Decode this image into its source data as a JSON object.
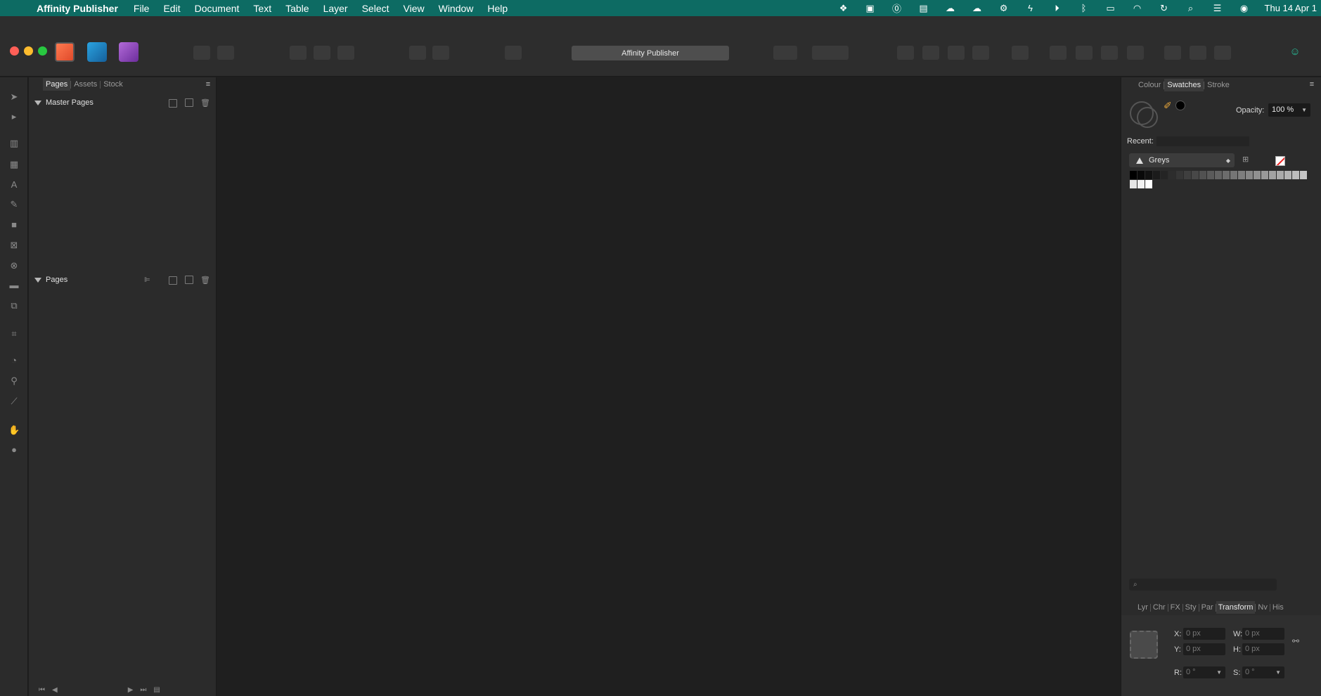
{
  "menubar": {
    "apple": "",
    "items": [
      "Affinity Publisher",
      "File",
      "Edit",
      "Document",
      "Text",
      "Table",
      "Layer",
      "Select",
      "View",
      "Window",
      "Help"
    ],
    "status_icons": [
      "dropbox-icon",
      "app-icon",
      "1password-icon",
      "app-icon",
      "cloud-icon",
      "cloud-icon",
      "gear-icon",
      "bolt-icon",
      "play-icon",
      "bluetooth-icon",
      "battery-icon",
      "wifi-icon",
      "time-machine-icon",
      "search-icon",
      "control-center-icon",
      "siri-icon"
    ],
    "clock": "Thu 14 Apr 1"
  },
  "toolbar": {
    "document_title": "Affinity Publisher"
  },
  "left_panel": {
    "tabs": [
      "Pages",
      "Assets",
      "Stock"
    ],
    "active_tab": "Pages",
    "master_pages_label": "Master Pages",
    "pages_label": "Pages"
  },
  "right_panel": {
    "tabs": [
      "Colour",
      "Swatches",
      "Stroke"
    ],
    "active_tab": "Swatches",
    "opacity_label": "Opacity:",
    "opacity_value": "100 %",
    "recent_label": "Recent:",
    "palette_name": "Greys",
    "bottom_tabs": [
      "Lyr",
      "Chr",
      "FX",
      "Sty",
      "Par",
      "Transform",
      "Nv",
      "His"
    ],
    "bottom_active_tab": "Transform",
    "transform": {
      "x_label": "X:",
      "x_value": "0 px",
      "y_label": "Y:",
      "y_value": "0 px",
      "w_label": "W:",
      "w_value": "0 px",
      "h_label": "H:",
      "h_value": "0 px",
      "r_label": "R:",
      "r_value": "0 °",
      "s_label": "S:",
      "s_value": "0 °"
    }
  },
  "colors": {
    "menubar_bg": "#0d6b63",
    "panel_bg": "#2b2b2b",
    "canvas_bg": "#1f1f1f",
    "accent_green": "#27c09a"
  }
}
